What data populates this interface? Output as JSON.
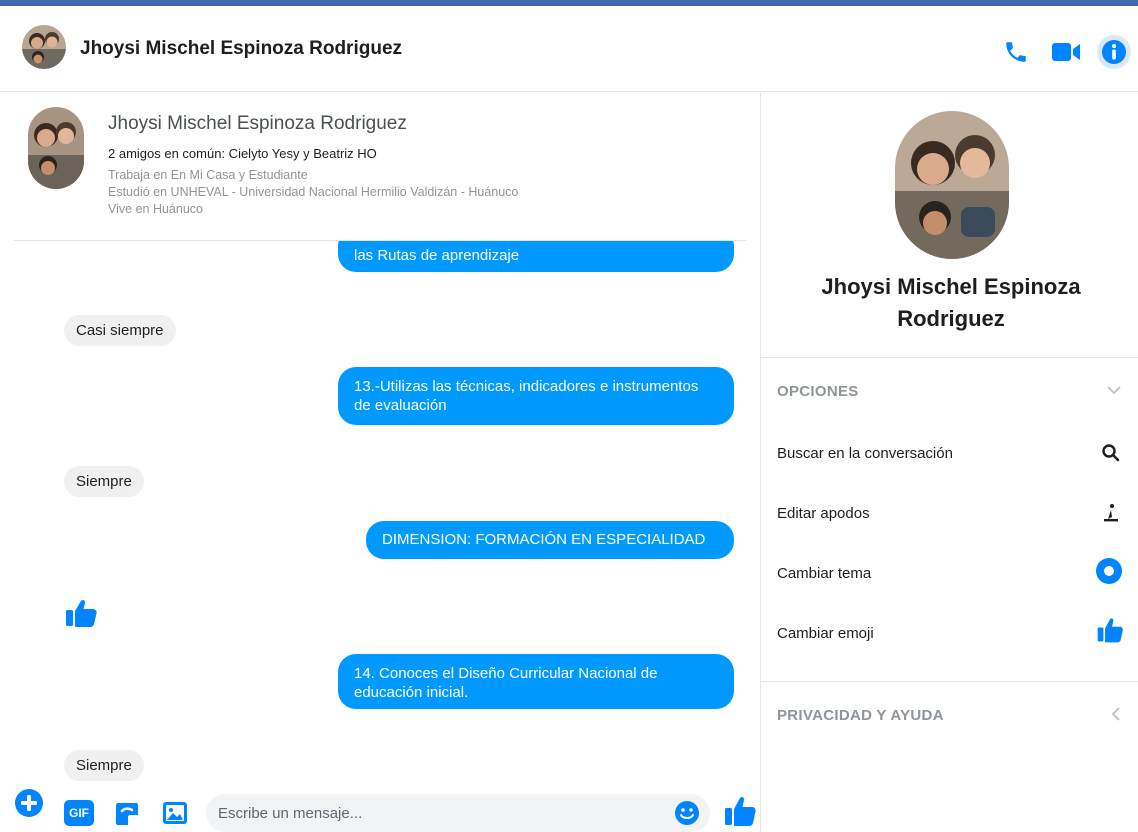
{
  "header": {
    "title": "Jhoysi Mischel Espinoza Rodriguez",
    "icons": [
      "phone-icon",
      "video-icon",
      "info-icon"
    ],
    "accent": "#0084ff"
  },
  "profile": {
    "name": "Jhoysi Mischel Espinoza Rodriguez",
    "mutual": "2 amigos en común: Cielyto Yesy y Beatriz HO",
    "work": "Trabaja en En Mi Casa y Estudiante",
    "study": "Estudió en UNHEVAL - Universidad Nacional Hermilio Valdizán - Huánuco",
    "lives": "Vive en Huánuco"
  },
  "messages": [
    {
      "dir": "out",
      "text": "las Rutas de aprendizaje"
    },
    {
      "dir": "in",
      "text": "Casi siempre"
    },
    {
      "dir": "out",
      "text": "13.-Utilizas las técnicas, indicadores e instrumentos de evaluación"
    },
    {
      "dir": "in",
      "text": "Siempre"
    },
    {
      "dir": "out",
      "text": "DIMENSION: FORMACIÓN EN ESPECIALIDAD"
    },
    {
      "dir": "in",
      "kind": "like",
      "icon": "thumbs-up-icon"
    },
    {
      "dir": "out",
      "text": "14. Conoces el Diseño Curricular Nacional de educación inicial."
    },
    {
      "dir": "in",
      "text": "Siempre"
    }
  ],
  "composer": {
    "placeholder": "Escribe un mensaje...",
    "gif_label": "GIF",
    "icons": [
      "plus-icon",
      "gif-icon",
      "sticker-icon",
      "image-icon",
      "emoji-icon",
      "thumbs-up-icon"
    ]
  },
  "sidebar": {
    "name": "Jhoysi Mischel Espinoza Rodriguez",
    "options_title": "OPCIONES",
    "options": [
      {
        "label": "Buscar en la conversación",
        "icon": "search-icon"
      },
      {
        "label": "Editar apodos",
        "icon": "nickname-icon"
      },
      {
        "label": "Cambiar tema",
        "icon": "theme-icon"
      },
      {
        "label": "Cambiar emoji",
        "icon": "thumbs-up-icon"
      }
    ],
    "privacy_title": "PRIVACIDAD Y AYUDA"
  },
  "colors": {
    "outgoing_bubble": "#0099ff",
    "incoming_bubble": "#f1f0f0",
    "icon_blue": "#0084ff"
  }
}
